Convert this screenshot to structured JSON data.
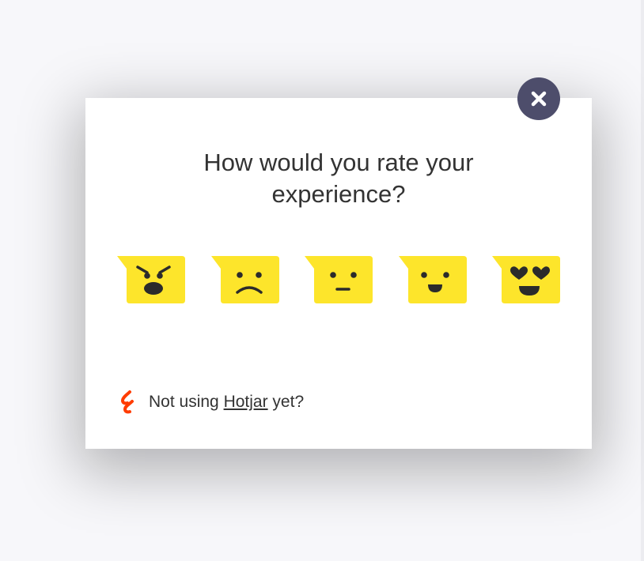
{
  "survey": {
    "question_line1": "How would you rate your",
    "question_line2": "experience?",
    "ratings": [
      {
        "name": "hate",
        "icon": "angry-face-icon"
      },
      {
        "name": "dislike",
        "icon": "sad-face-icon"
      },
      {
        "name": "neutral",
        "icon": "neutral-face-icon"
      },
      {
        "name": "like",
        "icon": "smile-face-icon"
      },
      {
        "name": "love",
        "icon": "heart-eyes-face-icon"
      }
    ],
    "close_icon": "close-icon"
  },
  "footer": {
    "prefix": "Not using ",
    "link": "Hotjar",
    "suffix": " yet?",
    "logo_icon": "hotjar-logo-icon"
  },
  "colors": {
    "bubble": "#fde52b",
    "close_bg": "#4d4d6b",
    "face": "#2b2b2b",
    "logo": "#ff3c00"
  }
}
